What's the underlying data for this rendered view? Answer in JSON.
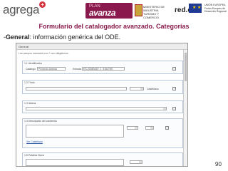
{
  "header": {
    "logo_text": "agrega",
    "logo_badge": "+",
    "plan_small": "PLAN",
    "plan_big": "avanza",
    "ministry_text": "MINISTERIO DE INDUSTRIA TURISMO Y COMERCIO",
    "redes_text": "red.es",
    "eu_text": "UNIÓN EUROPEA Fondo Europeo de Desarrollo Regional"
  },
  "title": "Formulario del catalogador avanzado. Categorías",
  "subtitle_prefix": "-",
  "subtitle_bold": "General",
  "subtitle_rest": ": información genérica del ODE.",
  "form": {
    "panel_title": "General",
    "note": "Los campos marcados con * son obligatorios.",
    "sections": [
      {
        "label": "1.1 Identificador",
        "field1_label": "Catálogo",
        "field1_value": "Proyecto Agrega",
        "field2_label": "Entrada",
        "field2_value": "ES-20080618_1_9154765"
      },
      {
        "label": "1.2 Título",
        "lang_label": "Castellano"
      },
      {
        "label": "1.3 Idioma"
      },
      {
        "label": "1.4 Descripción del contenido",
        "link": "Ver Castellano"
      },
      {
        "label": "1.5 Palabra Clave"
      }
    ]
  },
  "page_number": "90"
}
